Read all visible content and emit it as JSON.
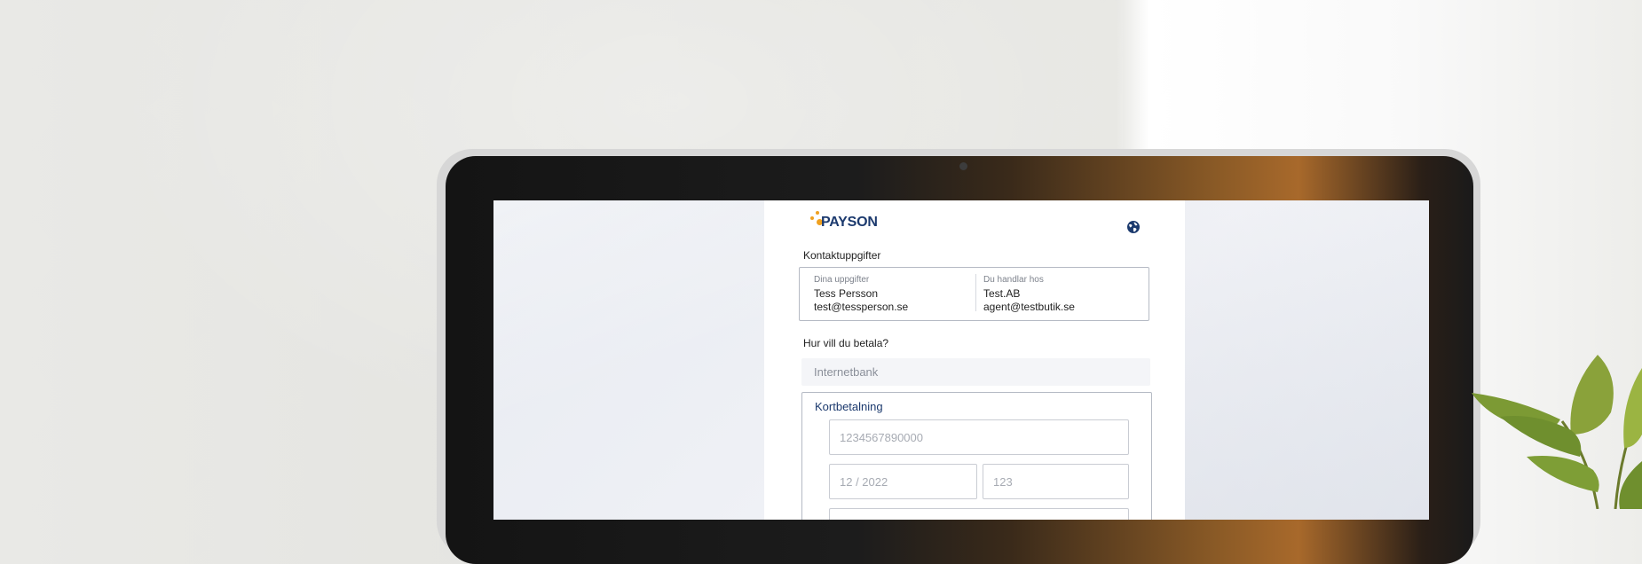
{
  "brand": {
    "name": "PAYSON",
    "primary_color": "#1c3a6e",
    "accent_color": "#f0a120"
  },
  "header": {
    "language_icon": "globe-icon"
  },
  "contact": {
    "section_title": "Kontaktuppgifter",
    "buyer": {
      "label": "Dina uppgifter",
      "name": "Tess Persson",
      "email": "test@tessperson.se"
    },
    "seller": {
      "label": "Du handlar hos",
      "name": "Test.AB",
      "email": "agent@testbutik.se"
    }
  },
  "payment": {
    "section_title": "Hur vill du betala?",
    "methods": [
      {
        "label": "Internetbank",
        "selected": false
      },
      {
        "label": "Kortbetalning",
        "selected": true
      }
    ],
    "card_form": {
      "card_number_placeholder": "1234567890000",
      "expiry_placeholder": "12 / 2022",
      "cvc_placeholder": "123"
    }
  }
}
